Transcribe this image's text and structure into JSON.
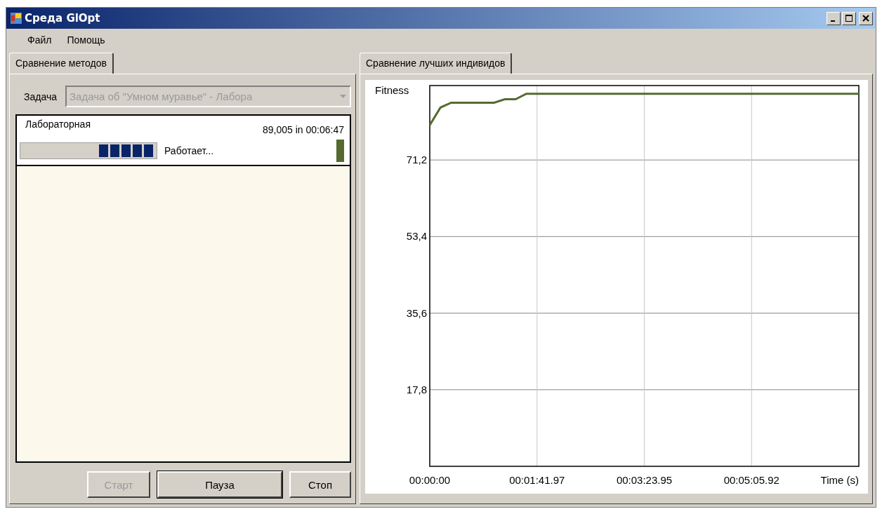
{
  "window": {
    "title": "Среда GlOpt"
  },
  "menu": [
    "Файл",
    "Помощь"
  ],
  "left_panel": {
    "tabs": [
      {
        "label": "Сравнение методов",
        "selected": true
      }
    ],
    "task": {
      "label": "Задача",
      "value": "Задача об \"Умном муравье\" - Лабора",
      "disabled": true
    },
    "runs": [
      {
        "name": "Лабораторная",
        "result": "89,005 in 00:06:47",
        "status": "Работает...",
        "level": 1,
        "color": "#556b2f"
      }
    ],
    "buttons": [
      {
        "label": "Старт",
        "disabled": true,
        "default": false
      },
      {
        "label": "Пауза",
        "disabled": false,
        "default": true
      },
      {
        "label": "Стоп",
        "disabled": false,
        "default": false
      }
    ]
  },
  "right_panel": {
    "tabs": [
      {
        "label": "Сравнение лучших индивидов",
        "selected": true
      }
    ],
    "chart_data": {
      "type": "line",
      "xlabel": "Time (s)",
      "ylabel": "Fitness",
      "categories": [
        "00:00:00",
        null,
        null,
        null,
        null,
        null,
        null,
        null,
        null,
        null,
        "00:01:41.97",
        null,
        null,
        null,
        null,
        null,
        null,
        null,
        null,
        null,
        "00:03:23.95",
        null,
        null,
        null,
        null,
        null,
        null,
        null,
        null,
        null,
        "00:05:05.92",
        null,
        null,
        null,
        null,
        null,
        null,
        null,
        null,
        null,
        null
      ],
      "series": [
        {
          "color": "#556b2f",
          "values": [
            79.3,
            83.4,
            84.5,
            84.5,
            84.5,
            84.5,
            84.5,
            85.3,
            85.3,
            86.6,
            86.6,
            86.6,
            86.6,
            86.6,
            86.6,
            86.6,
            86.6,
            86.6,
            86.6,
            86.6,
            86.6,
            86.6,
            86.6,
            86.6,
            86.6,
            86.6,
            86.6,
            86.6,
            86.6,
            86.6,
            86.6,
            86.6,
            86.6,
            86.6,
            86.6,
            86.6,
            86.6,
            86.6,
            86.6,
            86.6,
            86.6
          ]
        }
      ],
      "ylim": [
        0,
        88.5
      ],
      "grid": true,
      "yticks": [
        {
          "value": 17.8,
          "label": "17,8"
        },
        {
          "value": 35.6,
          "label": "35,6"
        },
        {
          "value": 53.4,
          "label": "53,4"
        },
        {
          "value": 71.2,
          "label": "71,2"
        }
      ]
    }
  }
}
